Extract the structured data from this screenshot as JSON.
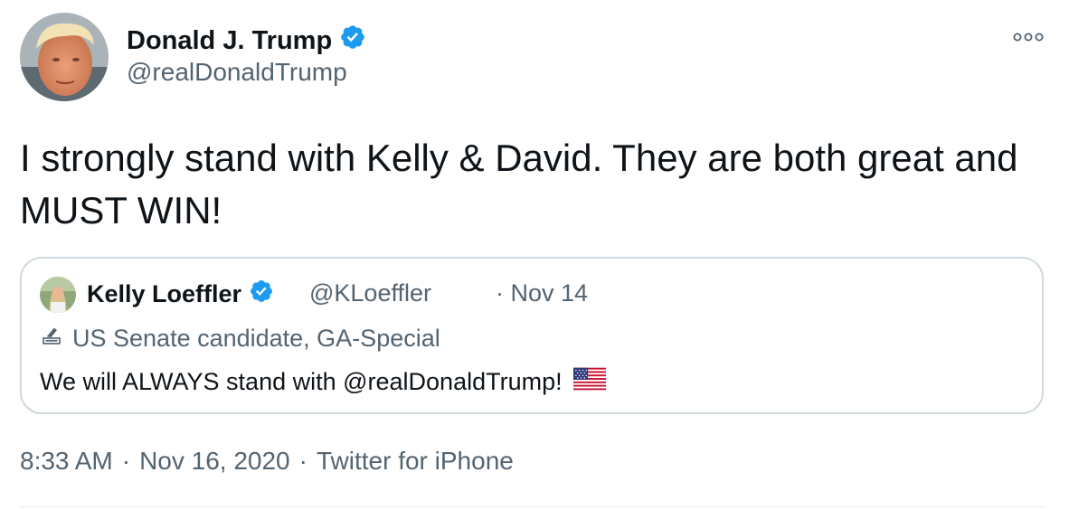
{
  "author": {
    "name": "Donald J. Trump",
    "handle": "@realDonaldTrump",
    "verified": true
  },
  "tweet": {
    "text": "I strongly stand with Kelly & David. They are both great and MUST WIN!"
  },
  "quoted": {
    "name": "Kelly Loeffler",
    "handle": "@KLoeffler",
    "date": "· Nov 14",
    "label": "US Senate candidate, GA-Special",
    "text": "We will ALWAYS stand with @realDonaldTrump!",
    "emoji": "us-flag"
  },
  "meta": {
    "time": "8:33 AM",
    "date": "Nov 16, 2020",
    "separator": "·",
    "source": "Twitter for iPhone"
  },
  "icons": {
    "verified": "verified-badge-icon",
    "more": "more-options-icon",
    "label": "ballot-box-icon"
  },
  "colors": {
    "verified": "#1d9bf0",
    "text": "#0f1419",
    "secondary": "#536471",
    "border": "#cfd9de"
  }
}
